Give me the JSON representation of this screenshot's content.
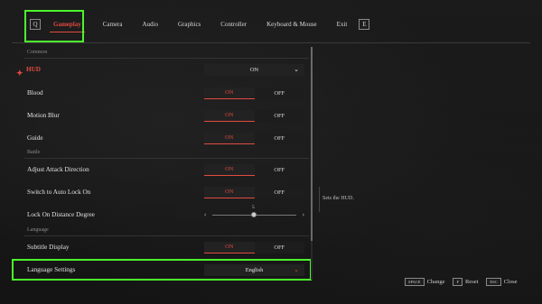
{
  "nav": {
    "left_key": "Q",
    "right_key": "E",
    "tabs": [
      "Gameplay",
      "Camera",
      "Audio",
      "Graphics",
      "Controller",
      "Keyboard & Mouse",
      "Exit"
    ]
  },
  "sections": {
    "common": "Common",
    "battle": "Battle",
    "language": "Language"
  },
  "settings": {
    "hud": {
      "label": "HUD",
      "value": "ON"
    },
    "blood": {
      "label": "Blood",
      "on": "ON",
      "off": "OFF"
    },
    "motion_blur": {
      "label": "Motion Blur",
      "on": "ON",
      "off": "OFF"
    },
    "guide": {
      "label": "Guide",
      "on": "ON",
      "off": "OFF"
    },
    "adjust_attack": {
      "label": "Adjust Attack Direction",
      "on": "ON",
      "off": "OFF"
    },
    "auto_lock": {
      "label": "Switch to Auto Lock On",
      "on": "ON",
      "off": "OFF"
    },
    "lock_distance": {
      "label": "Lock On Distance Degree",
      "value": "5"
    },
    "subtitle": {
      "label": "Subtitle Display",
      "on": "ON",
      "off": "OFF"
    },
    "language": {
      "label": "Language Settings",
      "value": "English"
    }
  },
  "description": "Sets the HUD.",
  "footer": {
    "change_key": "SPACE",
    "change_label": "Change",
    "reset_key": "F",
    "reset_label": "Reset",
    "close_key": "ESC",
    "close_label": "Close"
  },
  "colors": {
    "accent": "#e14a3f",
    "highlight": "#4cf52c"
  }
}
